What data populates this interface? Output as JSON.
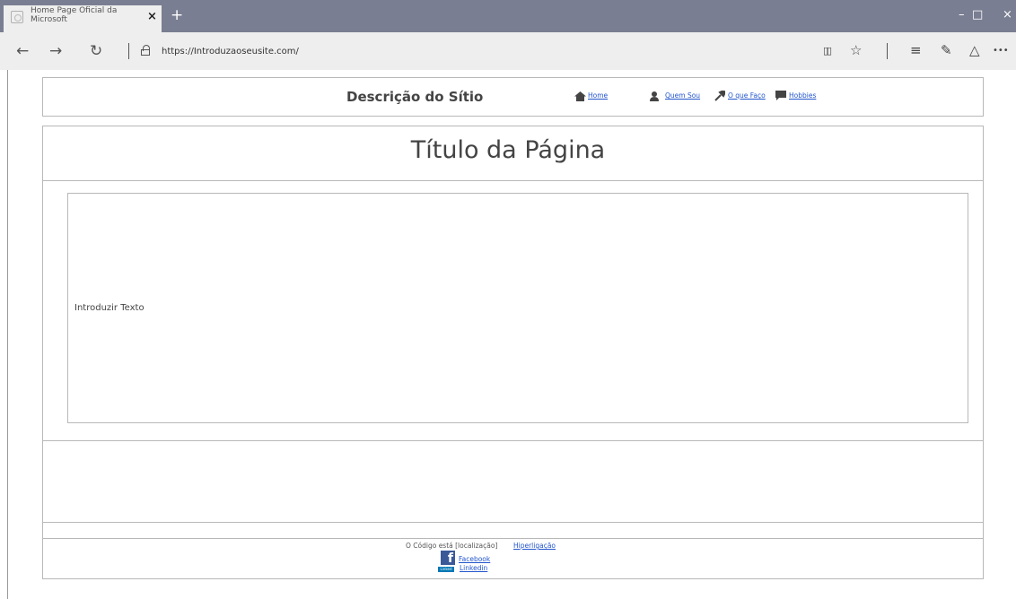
{
  "browser": {
    "tab_title": "Home Page Oficial da Microsoft",
    "tab_close": "×",
    "new_tab": "+",
    "minimize": "–",
    "maximize": "□",
    "close": "×",
    "back": "←",
    "forward": "→",
    "refresh": "↻",
    "url": "https://Introduzaoseusite.com/",
    "reading_view": "▯▯",
    "favorite": "☆",
    "hub": "≡",
    "notes": "✎",
    "share": "△",
    "more": "•••"
  },
  "header": {
    "site_description": "Descrição do Sítio",
    "nav": [
      {
        "label": "Home",
        "icon": "home-icon"
      },
      {
        "label": "Quem Sou",
        "icon": "person-icon"
      },
      {
        "label": "O que Faço",
        "icon": "tools-icon"
      },
      {
        "label": "Hobbies",
        "icon": "chat-icon"
      }
    ]
  },
  "main": {
    "page_title": "Título da Página",
    "intro_text": "Introduzir Texto"
  },
  "footer": {
    "code_text": "O Código está [localização]",
    "hyperlink": "Hiperligação",
    "facebook": "Facebook",
    "linkedin": "Linkedin",
    "fb_glyph": "f",
    "li_glyph": "Linked"
  },
  "colors": {
    "titlebar": "#7a7e92",
    "link": "#2255cc",
    "border": "#b8b8b8"
  }
}
